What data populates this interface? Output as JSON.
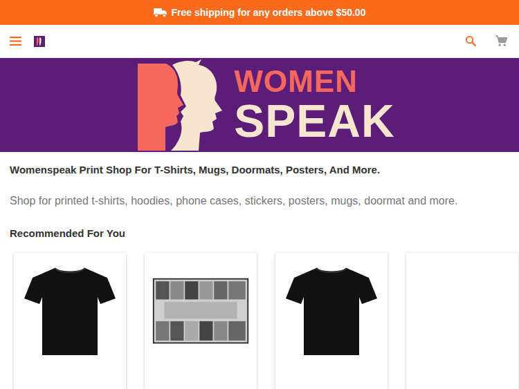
{
  "promo_bar": {
    "text": "Free shipping for any orders above $50.00"
  },
  "banner": {
    "logo_top": "WOMEN",
    "logo_bottom": "SPEAK"
  },
  "intro": {
    "title": "Womenspeak Print Shop For T-Shirts, Mugs, Doormats, Posters, And More.",
    "description": "Shop for printed t-shirts, hoodies, phone cases, stickers, posters, mugs, doormat and more."
  },
  "recommended": {
    "heading": "Recommended For You",
    "products": [
      {
        "kind": "tshirt"
      },
      {
        "kind": "poster"
      },
      {
        "kind": "tshirt"
      },
      {
        "kind": "empty"
      }
    ]
  }
}
